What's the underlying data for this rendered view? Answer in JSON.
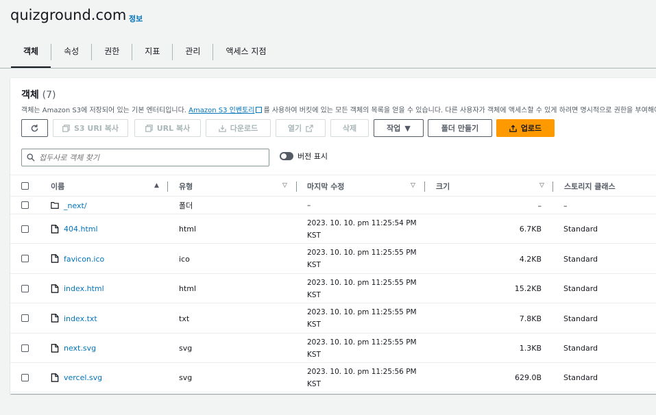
{
  "header": {
    "bucket_name": "quizground.com",
    "info_label": "정보"
  },
  "tabs": [
    {
      "label": "객체",
      "active": true
    },
    {
      "label": "속성",
      "active": false
    },
    {
      "label": "권한",
      "active": false
    },
    {
      "label": "지표",
      "active": false
    },
    {
      "label": "관리",
      "active": false
    },
    {
      "label": "액세스 지점",
      "active": false
    }
  ],
  "objects_panel": {
    "title": "객체",
    "count": "(7)",
    "desc_prefix": "객체는 Amazon S3에 저장되어 있는 기본 엔터티입니다. ",
    "desc_link": "Amazon S3 인벤토리",
    "desc_suffix": "를 사용하여 버킷에 있는 모든 객체의 목록을 얻을 수 있습니다. 다른 사용자가 객체에 액세스할 수 있게 하려면 명시적으로 권한을 부여해야 합니다."
  },
  "toolbar": {
    "copy_s3_uri": "S3 URI 복사",
    "copy_url": "URL 복사",
    "download": "다운로드",
    "open": "열기",
    "delete": "삭제",
    "actions": "작업",
    "create_folder": "폴더 만들기",
    "upload": "업로드"
  },
  "search": {
    "placeholder": "접두사로 객체 찾기"
  },
  "versions_toggle": {
    "label": "버전 표시"
  },
  "table": {
    "headers": {
      "name": "이름",
      "type": "유형",
      "modified": "마지막 수정",
      "size": "크기",
      "storage": "스토리지 클래스"
    },
    "rows": [
      {
        "name": "_next/",
        "type": "폴더",
        "modified_date": "–",
        "modified_tz": "",
        "size": "–",
        "storage": "–",
        "kind": "folder"
      },
      {
        "name": "404.html",
        "type": "html",
        "modified_date": "2023. 10. 10. pm 11:25:54 PM",
        "modified_tz": "KST",
        "size": "6.7KB",
        "storage": "Standard",
        "kind": "file"
      },
      {
        "name": "favicon.ico",
        "type": "ico",
        "modified_date": "2023. 10. 10. pm 11:25:55 PM",
        "modified_tz": "KST",
        "size": "4.2KB",
        "storage": "Standard",
        "kind": "file"
      },
      {
        "name": "index.html",
        "type": "html",
        "modified_date": "2023. 10. 10. pm 11:25:55 PM",
        "modified_tz": "KST",
        "size": "15.2KB",
        "storage": "Standard",
        "kind": "file"
      },
      {
        "name": "index.txt",
        "type": "txt",
        "modified_date": "2023. 10. 10. pm 11:25:55 PM",
        "modified_tz": "KST",
        "size": "7.8KB",
        "storage": "Standard",
        "kind": "file"
      },
      {
        "name": "next.svg",
        "type": "svg",
        "modified_date": "2023. 10. 10. pm 11:25:55 PM",
        "modified_tz": "KST",
        "size": "1.3KB",
        "storage": "Standard",
        "kind": "file"
      },
      {
        "name": "vercel.svg",
        "type": "svg",
        "modified_date": "2023. 10. 10. pm 11:25:56 PM",
        "modified_tz": "KST",
        "size": "629.0B",
        "storage": "Standard",
        "kind": "file"
      }
    ]
  },
  "colors": {
    "link": "#0073bb",
    "primary_button": "#ff9900",
    "text": "#16191f",
    "muted": "#545b64",
    "background": "#f2f3f3"
  }
}
